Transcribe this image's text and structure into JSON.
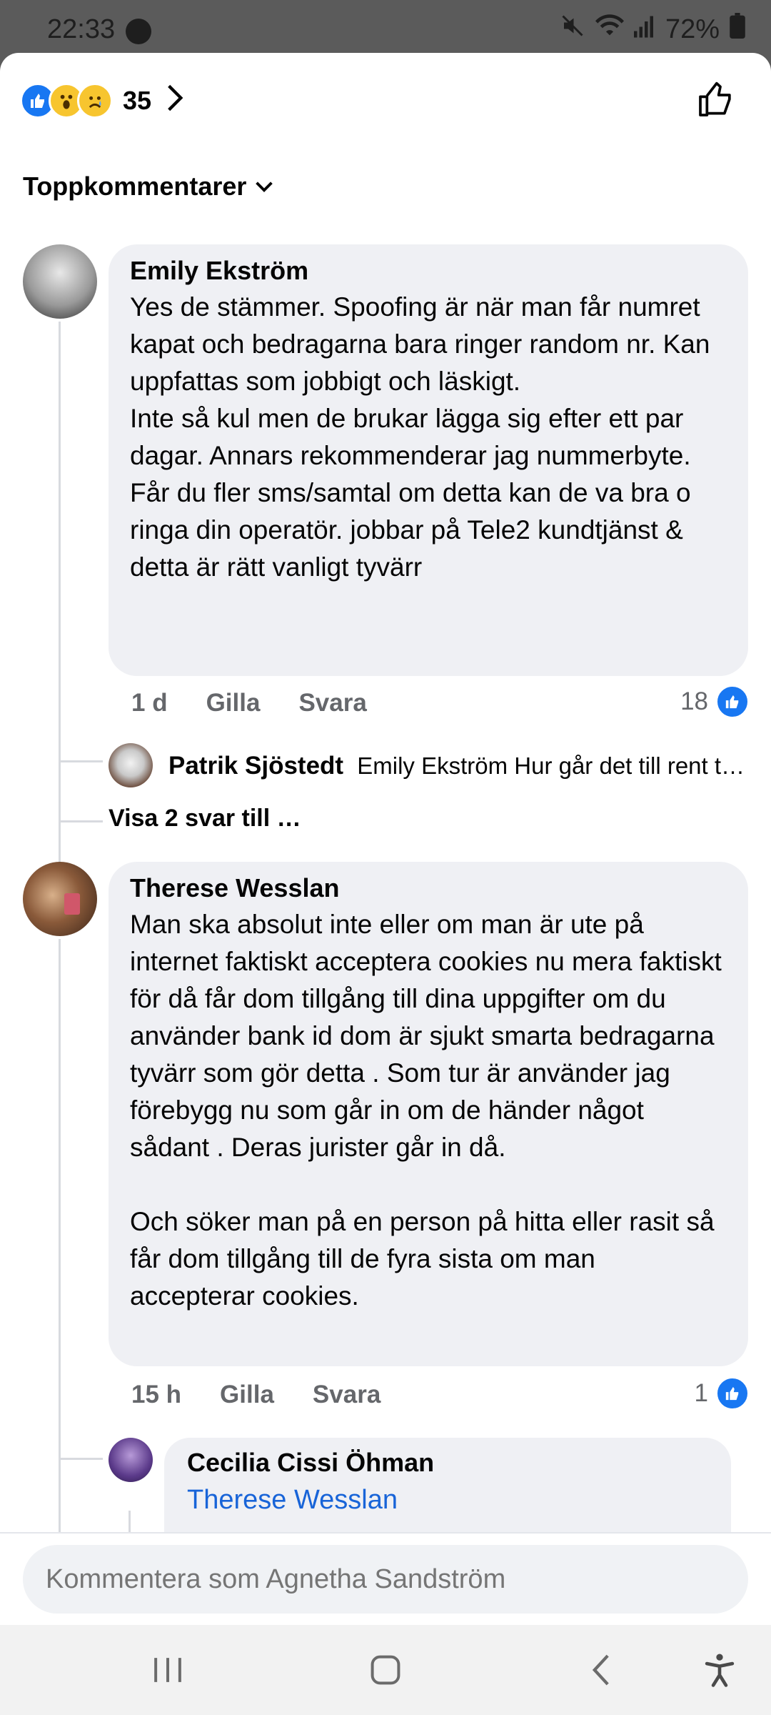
{
  "status": {
    "time": "22:33",
    "battery": "72%"
  },
  "reactions": {
    "count": "35"
  },
  "sort": {
    "label": "Toppkommentarer"
  },
  "comments": [
    {
      "author": "Emily Ekström",
      "text": "Yes de stämmer. Spoofing är när man får numret kapat och bedragarna bara ringer random nr. Kan uppfattas som jobbigt och läskigt.\nInte så kul men de brukar lägga sig efter ett par dagar. Annars rekommenderar jag nummerbyte. Får du fler sms/samtal om detta kan de va bra o ringa din operatör. jobbar på Tele2 kundtjänst & detta är rätt vanligt tyvärr",
      "time": "1 d",
      "like_label": "Gilla",
      "reply_label": "Svara",
      "likes": "18",
      "reply": {
        "author": "Patrik Sjöstedt",
        "text": "Emily Ekström Hur går det till rent t…"
      },
      "more_replies": "Visa 2 svar till …"
    },
    {
      "author": "Therese Wesslan",
      "text": "Man ska absolut inte eller om man är ute på internet faktiskt acceptera cookies nu mera faktiskt för då får dom tillgång till dina uppgifter om du använder bank id dom är sjukt smarta bedragarna tyvärr som gör detta . Som tur är använder jag förebygg nu som går in om de händer något sådant . Deras jurister går in då.\n\nOch söker man på en person på hitta eller rasit så får dom tillgång till de fyra sista om man accepterar cookies.",
      "time": "15 h",
      "like_label": "Gilla",
      "reply_label": "Svara",
      "likes": "1",
      "reply": {
        "author": "Cecilia Cissi Öhman",
        "mention": "Therese Wesslan"
      }
    }
  ],
  "composer": {
    "placeholder": "Kommentera som Agnetha Sandström"
  }
}
